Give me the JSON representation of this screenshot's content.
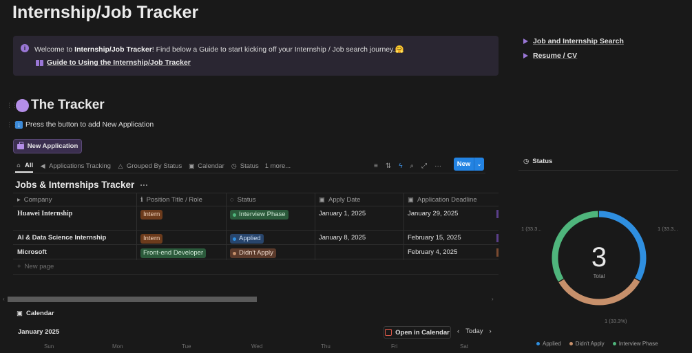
{
  "page": {
    "title": "Internship/Job Tracker"
  },
  "callout": {
    "text_prefix": "Welcome to ",
    "text_bold": "Internship/Job Tracker",
    "text_suffix": "! Find below a Guide to start kicking off your Internship / Job search journey.",
    "emoji": "🤗",
    "guide_link": "Guide to Using the Internship/Job Tracker"
  },
  "side_toggles": [
    {
      "label": "Job and Internship Search"
    },
    {
      "label": "Resume / CV"
    }
  ],
  "tracker": {
    "heading": "The Tracker",
    "instruction": "Press the button to add New Application",
    "new_application_button": "New Application"
  },
  "views": {
    "tabs": [
      {
        "label": "All",
        "icon": "home-icon",
        "active": true
      },
      {
        "label": "Applications Tracking",
        "icon": "megaphone-icon"
      },
      {
        "label": "Grouped By Status",
        "icon": "shapes-icon"
      },
      {
        "label": "Calendar",
        "icon": "calendar-icon"
      },
      {
        "label": "Status",
        "icon": "clock-icon"
      }
    ],
    "more": "1 more...",
    "new_button": "New"
  },
  "database": {
    "title": "Jobs & Internships Tracker",
    "columns": [
      {
        "label": "Company",
        "icon": "triangle-icon"
      },
      {
        "label": "Position Title / Role",
        "icon": "info-icon"
      },
      {
        "label": "Status",
        "icon": "status-icon"
      },
      {
        "label": "Apply Date",
        "icon": "calendar-icon"
      },
      {
        "label": "Application Deadline",
        "icon": "calendar-icon"
      }
    ],
    "rows": [
      {
        "company": "Huawei Internship",
        "role": "Intern",
        "status": "Interview Phase",
        "apply_date": "January 1, 2025",
        "deadline": "January 29, 2025"
      },
      {
        "company": "AI & Data Science Internship",
        "role": "Intern",
        "status": "Applied",
        "apply_date": "January 8, 2025",
        "deadline": "February 15, 2025"
      },
      {
        "company": "Microsoft",
        "role": "Front-end Developer",
        "status": "Didn't Apply",
        "apply_date": "",
        "deadline": "February 4, 2025"
      }
    ],
    "new_page": "New page"
  },
  "calendar": {
    "label": "Calendar",
    "month": "January 2025",
    "open_button": "Open in Calendar",
    "today": "Today",
    "weekdays": [
      "Sun",
      "Mon",
      "Tue",
      "Wed",
      "Thu",
      "Fri",
      "Sat"
    ]
  },
  "status_chart": {
    "label": "Status",
    "total_value": "3",
    "total_label": "Total",
    "annotations": {
      "left": "1 (33.3...",
      "right": "1 (33.3...",
      "bottom": "1 (33.3%)"
    }
  },
  "colors": {
    "applied": "#2f8fe0",
    "didnt_apply": "#c7906b",
    "interview_phase": "#4fb57c",
    "accent_purple": "#9a77d6",
    "new_button_blue": "#2383e2"
  },
  "chart_data": {
    "type": "pie",
    "title": "",
    "categories": [
      "Applied",
      "Didn't Apply",
      "Interview Phase"
    ],
    "values": [
      1,
      1,
      1
    ],
    "center_value": 3,
    "center_label": "Total",
    "legend": "bottom"
  }
}
